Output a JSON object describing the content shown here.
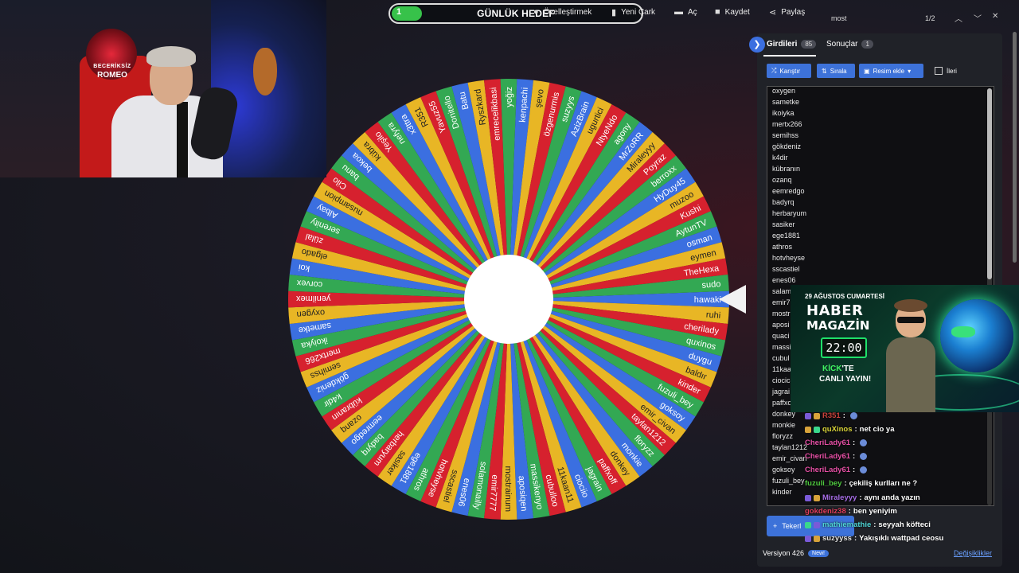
{
  "toolbar": {
    "progress_value": "1",
    "progress_fraction": 0.12,
    "title": "GÜNLÜK HEDEF",
    "customize": "Özelleştirmek",
    "new_wheel": "Yeni Çark",
    "open": "Aç",
    "save": "Kaydet",
    "share": "Paylaş"
  },
  "find": {
    "query": "most",
    "count": "1/2"
  },
  "webcam": {
    "logo_top": "BECERİKSİZ",
    "logo_bottom": "ROMEO"
  },
  "wheel": {
    "colors": [
      "#3b6fe0",
      "#e8b625",
      "#d6212e",
      "#33a853"
    ],
    "entries": [
      "hawaki",
      "ruhi",
      "cheriladу",
      "quxinos",
      "duygu",
      "baldır",
      "kinder",
      "fuzuli_bey",
      "goksoy",
      "emir_civan",
      "taylan1212",
      "floryzz",
      "monkie",
      "donkey",
      "paffxoff",
      "jagrain",
      "ciociio",
      "11kaan11",
      "cubulloo",
      "massikenyo",
      "aposiqen",
      "mostrainum",
      "emir7777",
      "solamonailly",
      "enes06",
      "sscastiel",
      "hotvheyse",
      "athros",
      "ege1881",
      "sasiker",
      "herbaryum",
      "badyrq",
      "eemredgo",
      "ozanq",
      "kübranın",
      "k4dir",
      "gökdeniz",
      "semihss",
      "mertx266",
      "ikoiyka",
      "sametke",
      "oxygen",
      "yenilmex",
      "corvex",
      "koi",
      "elgado",
      "zülal",
      "serenity",
      "Albay",
      "nusampion",
      "Cilo",
      "banu",
      "bekoa",
      "kübra",
      "Yeşilo",
      "nefyra",
      "x3ttra",
      "R351",
      "Yavuz55",
      "Donitello",
      "Batu",
      "Ryszkard",
      "emrecelikbasi",
      "yoğiz",
      "kenpachi",
      "şevo",
      "özgenurmis",
      "suzyys",
      "AzizBrain",
      "ugurtici",
      "NtyeNdo",
      "agony",
      "MrZoRR",
      "Miraleyyy",
      "Poyraz",
      "berroxx",
      "HyDuy45",
      "muzoo",
      "Kushi",
      "AytunTV",
      "osman",
      "eymen",
      "TheHexa",
      "sudo"
    ]
  },
  "panel": {
    "tab_entries": "Girdileri",
    "tab_entries_count": "85",
    "tab_results": "Sonuçlar",
    "tab_results_count": "1",
    "shuffle": "Karıştır",
    "sort": "Sırala",
    "add_image": "Resim ekle",
    "advanced": "İleri",
    "entries": [
      "oxygen",
      "sametke",
      "ikoiyka",
      "mertx266",
      "semihss",
      "gökdeniz",
      "k4dir",
      "kübranın",
      "ozanq",
      "eemredgo",
      "badyrq",
      "herbaryum",
      "sasiker",
      "ege1881",
      "athros",
      "hotvheyse",
      "sscastiel",
      "enes06",
      "salam",
      "emir7",
      "mostr",
      "aposi",
      "quaci",
      "massi",
      "cubul",
      "11kaa",
      "ciocic",
      "jagrai",
      "paffxo",
      "donkey",
      "monkie",
      "floryzz",
      "taylan1212",
      "emir_civan",
      "goksoy",
      "fuzuli_bey",
      "kinder"
    ],
    "add_wheel": "Tekerl",
    "version": "Versiyon 426",
    "new_badge": "New!",
    "changes": "Değişiklikler"
  },
  "ad": {
    "date": "29 AĞUSTOS CUMARTESİ",
    "title1": "HABER",
    "title2": "MAGAZİN",
    "time": "22:00",
    "kick": "KİCK",
    "kick_suffix": "'TE",
    "live": "CANLI YAYIN!"
  },
  "chat": [
    {
      "user": "R351",
      "color": "#c7423a",
      "msg": ""
    },
    {
      "user": "quXinos",
      "color": "#d8d338",
      "msg": "net cio ya"
    },
    {
      "user": "CheriLady61",
      "color": "#e64fa5",
      "msg": ""
    },
    {
      "user": "CheriLady61",
      "color": "#e64fa5",
      "msg": ""
    },
    {
      "user": "CheriLady61",
      "color": "#e64fa5",
      "msg": ""
    },
    {
      "user": "fuzuli_bey",
      "color": "#4fc93f",
      "msg": "çekiliş kurlları ne ?"
    },
    {
      "user": "Miraleyyy",
      "color": "#a86ee8",
      "msg": "aynı anda yazın"
    },
    {
      "user": "gokdeniz38",
      "color": "#e23e5c",
      "msg": "ben yeniyim"
    },
    {
      "user": "mathiemathie",
      "color": "#4fd6d6",
      "msg": "seyyah köfteci"
    },
    {
      "user": "suzyyss",
      "color": "#e0e0e0",
      "msg": "Yakışıklı wattpad ceosu"
    }
  ]
}
